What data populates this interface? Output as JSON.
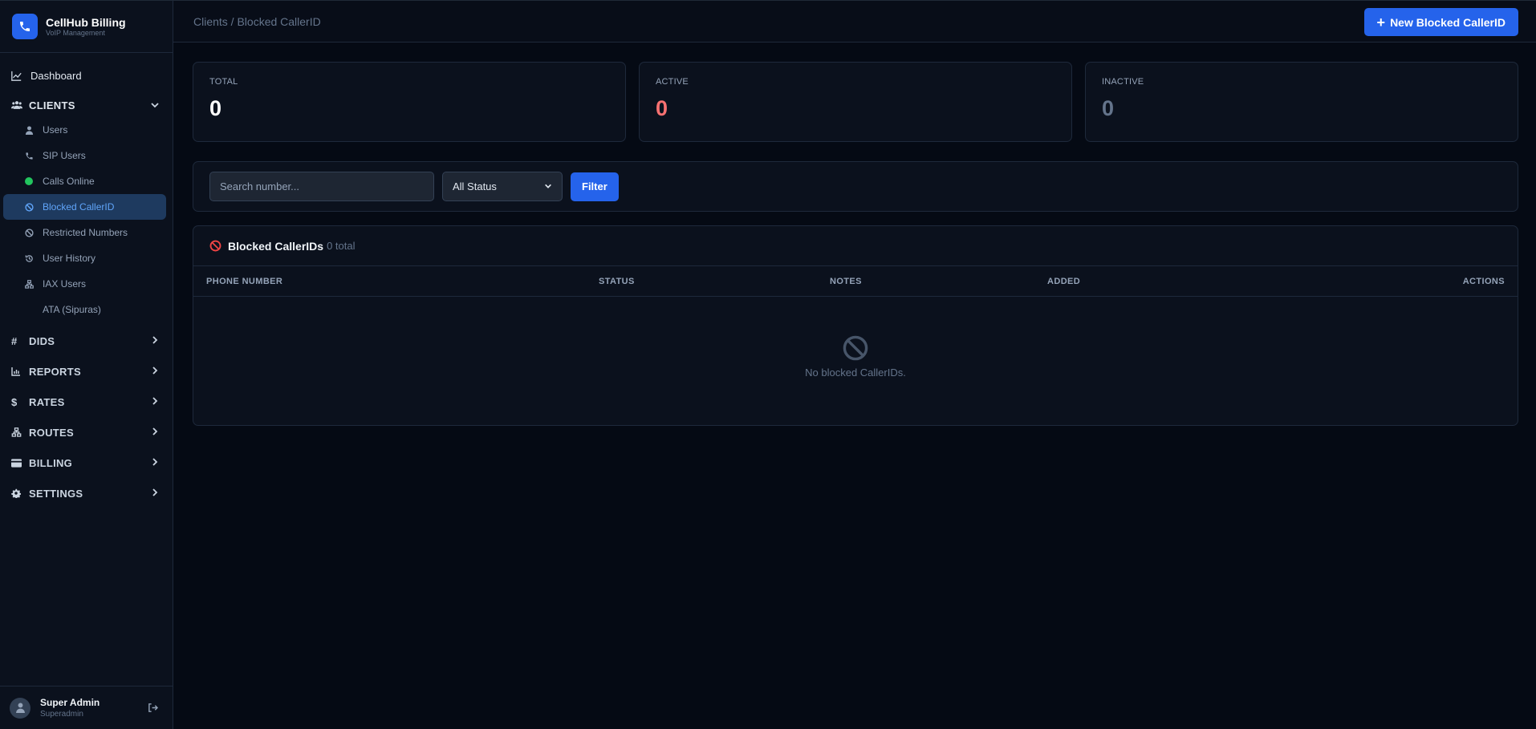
{
  "brand": {
    "title": "CellHub Billing",
    "subtitle": "VoIP Management"
  },
  "sidebar": {
    "dashboard": "Dashboard",
    "clients_section": "CLIENTS",
    "clients_items": [
      {
        "label": "Users",
        "icon": "user-icon"
      },
      {
        "label": "SIP Users",
        "icon": "phone-icon"
      },
      {
        "label": "Calls Online",
        "icon": "online-dot-icon"
      },
      {
        "label": "Blocked CallerID",
        "icon": "ban-icon",
        "active": true
      },
      {
        "label": "Restricted Numbers",
        "icon": "ban-icon"
      },
      {
        "label": "User History",
        "icon": "history-icon"
      },
      {
        "label": "IAX Users",
        "icon": "network-icon"
      },
      {
        "label": "ATA (Sipuras)",
        "icon": ""
      }
    ],
    "sections": [
      {
        "label": "DIDS",
        "icon": "hash-icon"
      },
      {
        "label": "REPORTS",
        "icon": "chart-icon"
      },
      {
        "label": "RATES",
        "icon": "dollar-icon"
      },
      {
        "label": "ROUTES",
        "icon": "network-icon"
      },
      {
        "label": "BILLING",
        "icon": "card-icon"
      },
      {
        "label": "SETTINGS",
        "icon": "gear-icon"
      }
    ]
  },
  "user": {
    "name": "Super Admin",
    "role": "Superadmin"
  },
  "header": {
    "breadcrumb": "Clients / Blocked CallerID",
    "new_button": "New Blocked CallerID"
  },
  "stats": [
    {
      "label": "TOTAL",
      "value": "0",
      "color": "#ffffff"
    },
    {
      "label": "ACTIVE",
      "value": "0",
      "color": "#f87171"
    },
    {
      "label": "INACTIVE",
      "value": "0",
      "color": "#64748b"
    }
  ],
  "filter": {
    "search_placeholder": "Search number...",
    "status_selected": "All Status",
    "filter_button": "Filter"
  },
  "table": {
    "title": "Blocked CallerIDs",
    "count": "0 total",
    "columns": [
      "PHONE NUMBER",
      "STATUS",
      "NOTES",
      "ADDED",
      "ACTIONS"
    ],
    "empty_text": "No blocked CallerIDs."
  }
}
